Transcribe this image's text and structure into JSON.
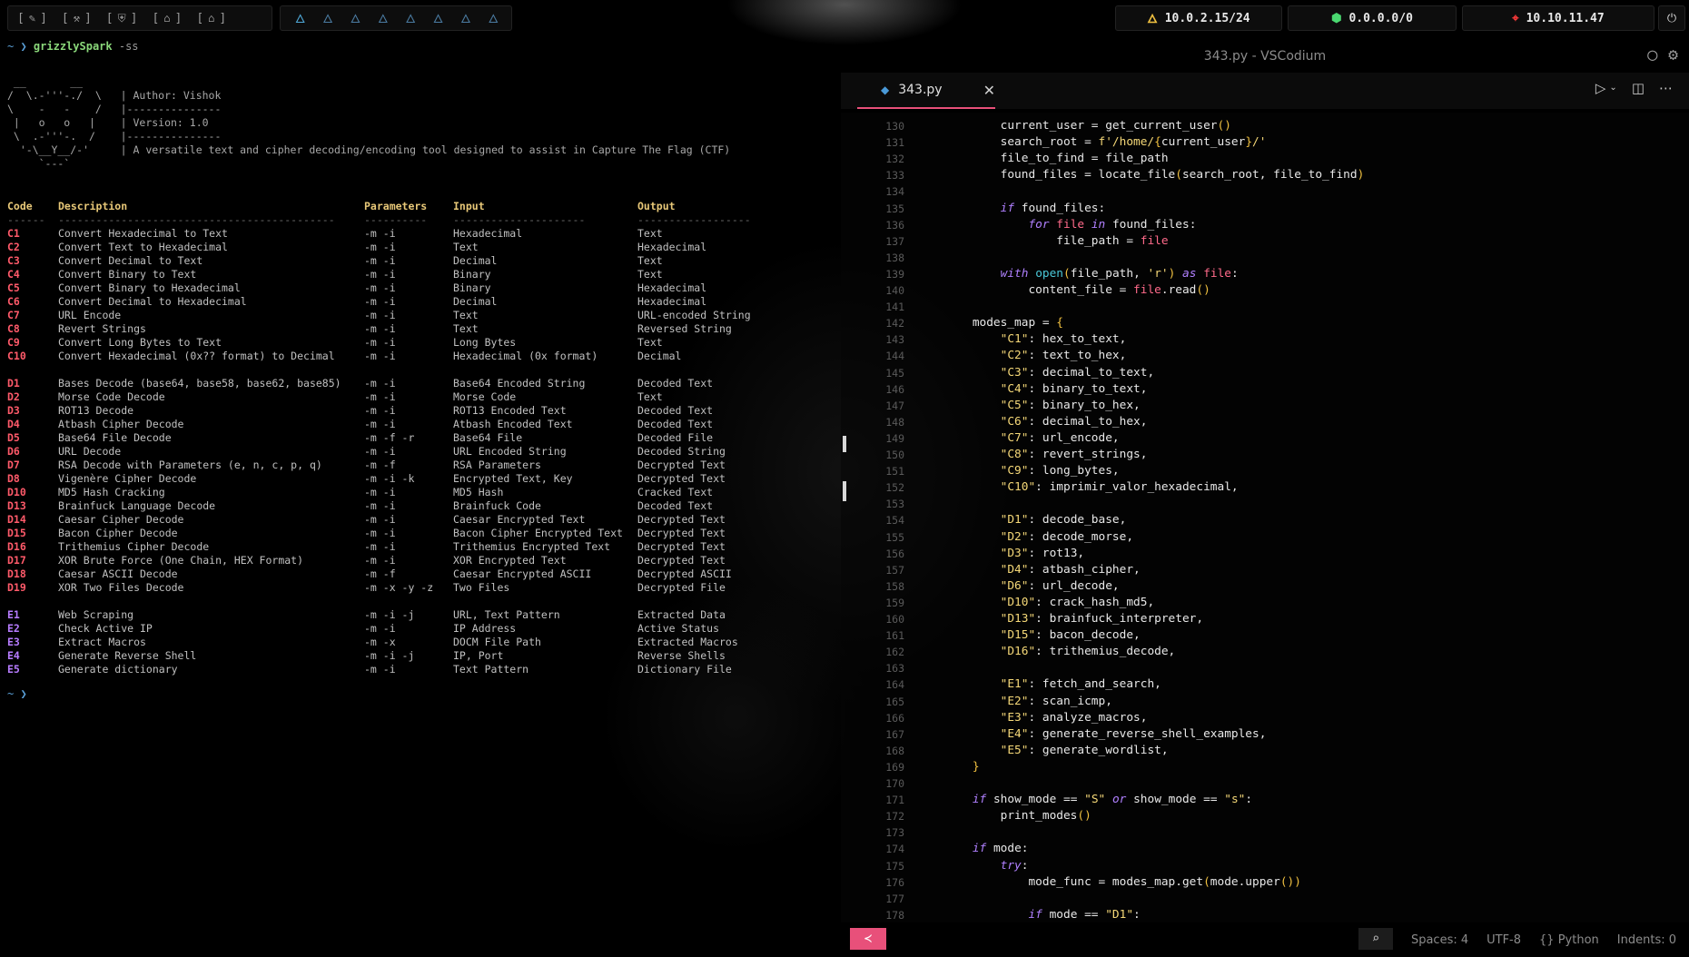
{
  "topbar": {
    "workspaces": [
      {
        "icon": "✎",
        "name": "pencil-icon"
      },
      {
        "icon": "⚒",
        "name": "hammer-icon"
      },
      {
        "icon": "⛨",
        "name": "shield-icon"
      },
      {
        "icon": "⌂",
        "name": "home-icon"
      },
      {
        "icon": "⌂",
        "name": "lock-icon"
      }
    ],
    "flames": [
      "🜂",
      "🜂",
      "🜂",
      "🜂",
      "🜂",
      "🜂",
      "🜂",
      "🜂"
    ],
    "net": [
      {
        "ip": "10.0.2.15/24",
        "color": "#f0c040"
      },
      {
        "ip": "0.0.0.0/0",
        "color": "#4ad870"
      },
      {
        "ip": "10.10.11.47",
        "color": "#ff3a3a"
      }
    ]
  },
  "terminal": {
    "prompt_symbol": "~ ❯",
    "command": "grizzlySpark",
    "flag": "-ss",
    "banner": [
      " __       __",
      "/  \\.-'''-./  \\   | Author: Vishok",
      "\\    -   -    /   |---------------",
      " |   o   o   |    | Version: 1.0",
      " \\  .-'''-.  /    |---------------",
      "  '-\\__Y__/-'     | A versatile text and cipher decoding/encoding tool designed to assist in Capture The Flag (CTF)",
      "     `---`"
    ],
    "headers": [
      "Code",
      "Description",
      "Parameters",
      "Input",
      "Output"
    ],
    "separators": [
      "------",
      "--------------------------------------------",
      "----------",
      "---------------------",
      "------------------"
    ],
    "groups": [
      {
        "color": "red",
        "rows": [
          [
            "C1",
            "Convert Hexadecimal to Text",
            "-m -i",
            "Hexadecimal",
            "Text"
          ],
          [
            "C2",
            "Convert Text to Hexadecimal",
            "-m -i",
            "Text",
            "Hexadecimal"
          ],
          [
            "C3",
            "Convert Decimal to Text",
            "-m -i",
            "Decimal",
            "Text"
          ],
          [
            "C4",
            "Convert Binary to Text",
            "-m -i",
            "Binary",
            "Text"
          ],
          [
            "C5",
            "Convert Binary to Hexadecimal",
            "-m -i",
            "Binary",
            "Hexadecimal"
          ],
          [
            "C6",
            "Convert Decimal to Hexadecimal",
            "-m -i",
            "Decimal",
            "Hexadecimal"
          ],
          [
            "C7",
            "URL Encode",
            "-m -i",
            "Text",
            "URL-encoded String"
          ],
          [
            "C8",
            "Revert Strings",
            "-m -i",
            "Text",
            "Reversed String"
          ],
          [
            "C9",
            "Convert Long Bytes to Text",
            "-m -i",
            "Long Bytes",
            "Text"
          ],
          [
            "C10",
            "Convert Hexadecimal (0x?? format) to Decimal",
            "-m -i",
            "Hexadecimal (0x format)",
            "Decimal"
          ]
        ]
      },
      {
        "color": "red",
        "rows": [
          [
            "D1",
            "Bases Decode (base64, base58, base62, base85)",
            "-m -i",
            "Base64 Encoded String",
            "Decoded Text"
          ],
          [
            "D2",
            "Morse Code Decode",
            "-m -i",
            "Morse Code",
            "Text"
          ],
          [
            "D3",
            "ROT13 Decode",
            "-m -i",
            "ROT13 Encoded Text",
            "Decoded Text"
          ],
          [
            "D4",
            "Atbash Cipher Decode",
            "-m -i",
            "Atbash Encoded Text",
            "Decoded Text"
          ],
          [
            "D5",
            "Base64 File Decode",
            "-m -f -r",
            "Base64 File",
            "Decoded File"
          ],
          [
            "D6",
            "URL Decode",
            "-m -i",
            "URL Encoded String",
            "Decoded String"
          ],
          [
            "D7",
            "RSA Decode with Parameters (e, n, c, p, q)",
            "-m -f",
            "RSA Parameters",
            "Decrypted Text"
          ],
          [
            "D8",
            "Vigenère Cipher Decode",
            "-m -i -k",
            "Encrypted Text, Key",
            "Decrypted Text"
          ],
          [
            "D10",
            "MD5 Hash Cracking",
            "-m -i",
            "MD5 Hash",
            "Cracked Text"
          ],
          [
            "D13",
            "Brainfuck Language Decode",
            "-m -i",
            "Brainfuck Code",
            "Decoded Text"
          ],
          [
            "D14",
            "Caesar Cipher Decode",
            "-m -i",
            "Caesar Encrypted Text",
            "Decrypted Text"
          ],
          [
            "D15",
            "Bacon Cipher Decode",
            "-m -i",
            "Bacon Cipher Encrypted Text",
            "Decrypted Text"
          ],
          [
            "D16",
            "Trithemius Cipher Decode",
            "-m -i",
            "Trithemius Encrypted Text",
            "Decrypted Text"
          ],
          [
            "D17",
            "XOR Brute Force (One Chain, HEX Format)",
            "-m -i",
            "XOR Encrypted Text",
            "Decrypted Text"
          ],
          [
            "D18",
            "Caesar ASCII Decode",
            "-m -f",
            "Caesar Encrypted ASCII",
            "Decrypted ASCII"
          ],
          [
            "D19",
            "XOR Two Files Decode",
            "-m -x -y -z",
            "Two Files",
            "Decrypted File"
          ]
        ]
      },
      {
        "color": "purple",
        "rows": [
          [
            "E1",
            "Web Scraping",
            "-m -i -j",
            "URL, Text Pattern",
            "Extracted Data"
          ],
          [
            "E2",
            "Check Active IP",
            "-m -i",
            "IP Address",
            "Active Status"
          ],
          [
            "E3",
            "Extract Macros",
            "-m -x",
            "DOCM File Path",
            "Extracted Macros"
          ],
          [
            "E4",
            "Generate Reverse Shell",
            "-m -i -j",
            "IP, Port",
            "Reverse Shells"
          ],
          [
            "E5",
            "Generate dictionary",
            "-m -i",
            "Text Pattern",
            "Dictionary File"
          ]
        ]
      }
    ],
    "end_prompt": "~ ❯"
  },
  "vscode": {
    "window_title": "343.py - VSCodium",
    "tab_label": "343.py",
    "status": {
      "spaces": "Spaces: 4",
      "encoding": "UTF-8",
      "language": "{} Python",
      "indents": "Indents: 0"
    },
    "code_lines": [
      {
        "n": "130",
        "html": "        current_user = <span class='fn'>get_current_user</span><span class='br'>()</span>"
      },
      {
        "n": "131",
        "html": "        search_root = <span class='str'>f'/home/</span><span class='br'>{</span>current_user<span class='br'>}</span><span class='str'>/'</span>"
      },
      {
        "n": "132",
        "html": "        file_to_find = file_path"
      },
      {
        "n": "133",
        "html": "        found_files = locate_file<span class='br'>(</span>search_root, file_to_find<span class='br'>)</span>"
      },
      {
        "n": "134",
        "html": ""
      },
      {
        "n": "135",
        "html": "        <span class='kw'>if</span> found_files:"
      },
      {
        "n": "136",
        "html": "            <span class='kw'>for</span> <span class='var'>file</span> <span class='kw'>in</span> found_files:"
      },
      {
        "n": "137",
        "html": "                file_path = <span class='var'>file</span>"
      },
      {
        "n": "138",
        "html": ""
      },
      {
        "n": "139",
        "html": "        <span class='kw'>with</span> <span class='bi'>open</span><span class='br'>(</span>file_path, <span class='str'>'r'</span><span class='br'>)</span> <span class='kw'>as</span> <span class='var'>file</span>:"
      },
      {
        "n": "140",
        "html": "            content_file = <span class='var'>file</span>.read<span class='br'>()</span>"
      },
      {
        "n": "141",
        "html": ""
      },
      {
        "n": "142",
        "html": "    modes_map = <span class='br'>{</span>"
      },
      {
        "n": "143",
        "html": "        <span class='str'>\"C1\"</span>: hex_to_text,"
      },
      {
        "n": "144",
        "html": "        <span class='str'>\"C2\"</span>: text_to_hex,"
      },
      {
        "n": "145",
        "html": "        <span class='str'>\"C3\"</span>: decimal_to_text,"
      },
      {
        "n": "146",
        "html": "        <span class='str'>\"C4\"</span>: binary_to_text,"
      },
      {
        "n": "147",
        "html": "        <span class='str'>\"C5\"</span>: binary_to_hex,"
      },
      {
        "n": "148",
        "html": "        <span class='str'>\"C6\"</span>: decimal_to_hex,"
      },
      {
        "n": "149",
        "html": "        <span class='str'>\"C7\"</span>: url_encode,"
      },
      {
        "n": "150",
        "html": "        <span class='str'>\"C8\"</span>: revert_strings,"
      },
      {
        "n": "151",
        "html": "        <span class='str'>\"C9\"</span>: long_bytes,"
      },
      {
        "n": "152",
        "html": "        <span class='str'>\"C10\"</span>: imprimir_valor_hexadecimal,"
      },
      {
        "n": "153",
        "html": ""
      },
      {
        "n": "154",
        "html": "        <span class='str'>\"D1\"</span>: decode_base,"
      },
      {
        "n": "155",
        "html": "        <span class='str'>\"D2\"</span>: decode_morse,"
      },
      {
        "n": "156",
        "html": "        <span class='str'>\"D3\"</span>: rot13,"
      },
      {
        "n": "157",
        "html": "        <span class='str'>\"D4\"</span>: atbash_cipher,"
      },
      {
        "n": "158",
        "html": "        <span class='str'>\"D6\"</span>: url_decode,"
      },
      {
        "n": "159",
        "html": "        <span class='str'>\"D10\"</span>: crack_hash_md5,"
      },
      {
        "n": "160",
        "html": "        <span class='str'>\"D13\"</span>: brainfuck_interpreter,"
      },
      {
        "n": "161",
        "html": "        <span class='str'>\"D15\"</span>: bacon_decode,"
      },
      {
        "n": "162",
        "html": "        <span class='str'>\"D16\"</span>: trithemius_decode,"
      },
      {
        "n": "163",
        "html": ""
      },
      {
        "n": "164",
        "html": "        <span class='str'>\"E1\"</span>: fetch_and_search,"
      },
      {
        "n": "165",
        "html": "        <span class='str'>\"E2\"</span>: scan_icmp,"
      },
      {
        "n": "166",
        "html": "        <span class='str'>\"E3\"</span>: analyze_macros,"
      },
      {
        "n": "167",
        "html": "        <span class='str'>\"E4\"</span>: generate_reverse_shell_examples,"
      },
      {
        "n": "168",
        "html": "        <span class='str'>\"E5\"</span>: generate_wordlist,"
      },
      {
        "n": "169",
        "html": "    <span class='br'>}</span>"
      },
      {
        "n": "170",
        "html": ""
      },
      {
        "n": "171",
        "html": "    <span class='kw'>if</span> show_mode == <span class='str'>\"S\"</span> <span class='kw'>or</span> show_mode == <span class='str'>\"s\"</span>:"
      },
      {
        "n": "172",
        "html": "        print_modes<span class='br'>()</span>"
      },
      {
        "n": "173",
        "html": ""
      },
      {
        "n": "174",
        "html": "    <span class='kw'>if</span> mode:"
      },
      {
        "n": "175",
        "html": "        <span class='kw'>try</span>:"
      },
      {
        "n": "176",
        "html": "            mode_func = modes_map.get<span class='br'>(</span>mode.upper<span class='br'>())</span>"
      },
      {
        "n": "177",
        "html": ""
      },
      {
        "n": "178",
        "html": "            <span class='kw'>if</span> mode == <span class='str'>\"D1\"</span>:"
      }
    ]
  }
}
